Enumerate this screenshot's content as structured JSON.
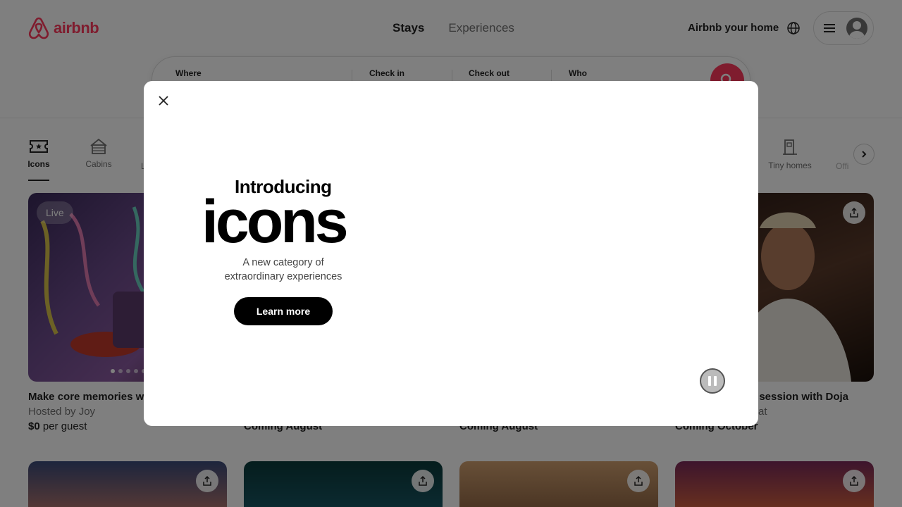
{
  "header": {
    "logo_text": "airbnb",
    "nav": {
      "stays": "Stays",
      "experiences": "Experiences"
    },
    "host_link": "Airbnb your home"
  },
  "search": {
    "where": "Where",
    "check_in": "Check in",
    "check_out": "Check out",
    "who": "Who"
  },
  "categories": {
    "icons": "Icons",
    "cabins": "Cabins",
    "partial_left": "L",
    "tiny_homes": "Tiny homes",
    "partial_right": "Offi"
  },
  "cards": [
    {
      "badge": "Live",
      "title": "Make core memories wi",
      "host": "Hosted by Joy",
      "price_bold": "$0",
      "price_rest": " per guest"
    },
    {
      "status": "Coming August"
    },
    {
      "status": "Coming August"
    },
    {
      "title": "n session with Doja",
      "host": "at",
      "status": "Coming October"
    }
  ],
  "modal": {
    "intro": "Introducing",
    "headline": "icons",
    "tagline": "A new category of extraordinary experiences",
    "button": "Learn more"
  },
  "colors": {
    "brand": "#ff385c",
    "text": "#222222",
    "muted": "#717171"
  }
}
